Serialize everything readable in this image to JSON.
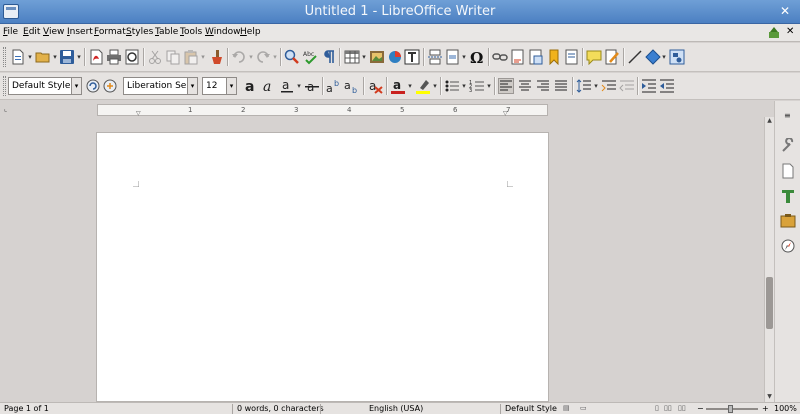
{
  "window": {
    "title": "Untitled 1 - LibreOffice Writer"
  },
  "menu": [
    "File",
    "Edit",
    "View",
    "Insert",
    "Format",
    "Styles",
    "Table",
    "Tools",
    "Window",
    "Help"
  ],
  "formatting": {
    "paragraph_style": "Default Style",
    "font_name": "Liberation Serif",
    "font_size": "12"
  },
  "ruler": {
    "ticks": [
      "1",
      "2",
      "3",
      "4",
      "5",
      "6",
      "7"
    ]
  },
  "status": {
    "page": "Page 1 of 1",
    "words": "0 words, 0 characters",
    "language": "English (USA)",
    "page_style": "Default Style",
    "zoom": "100%"
  },
  "colors": {
    "titlebar": "#4c80c2",
    "toolbar": "#e6e3e1",
    "page": "#ffffff"
  }
}
